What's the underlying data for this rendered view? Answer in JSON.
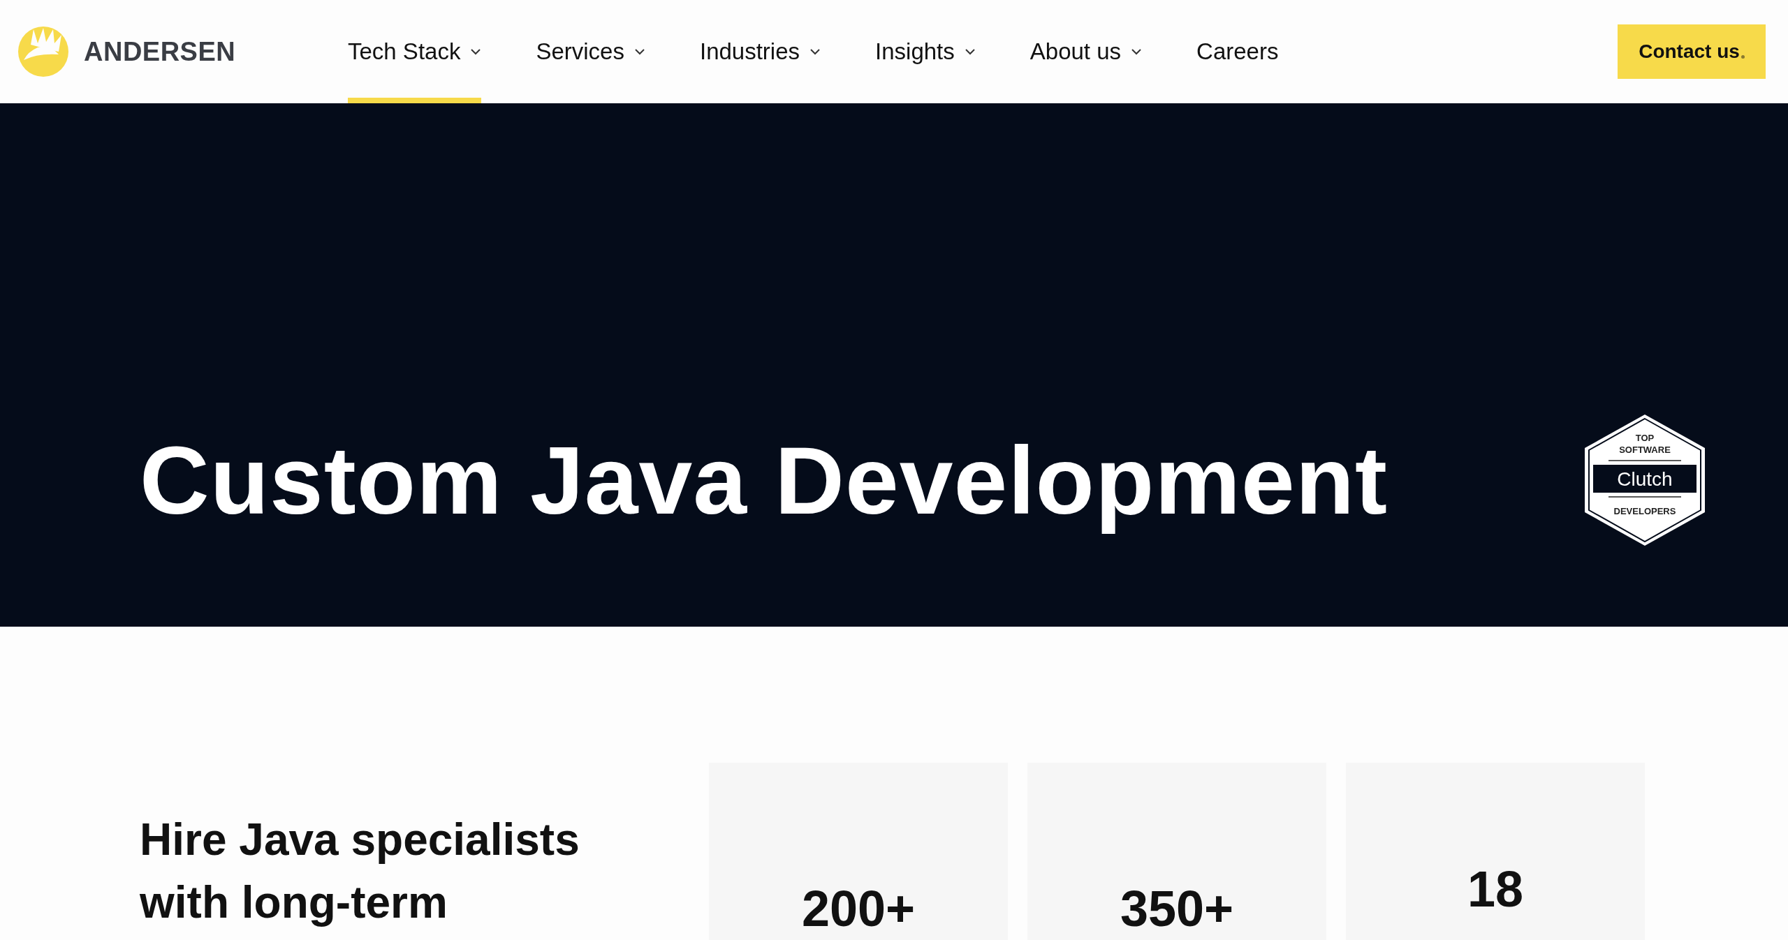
{
  "header": {
    "logo": "ANDERSEN",
    "nav": [
      {
        "label": "Tech Stack",
        "dropdown": true,
        "selected": true
      },
      {
        "label": "Services",
        "dropdown": true,
        "selected": false
      },
      {
        "label": "Industries",
        "dropdown": true,
        "selected": false
      },
      {
        "label": "Insights",
        "dropdown": true,
        "selected": false
      },
      {
        "label": "About us",
        "dropdown": true,
        "selected": false
      },
      {
        "label": "Careers",
        "dropdown": false,
        "selected": false
      }
    ],
    "contact_button": "Contact us"
  },
  "hero": {
    "title": "Custom Java Development",
    "badge": {
      "top": "TOP",
      "line2": "SOFTWARE",
      "brand": "Clutch",
      "bottom": "DEVELOPERS"
    }
  },
  "intro": {
    "heading": "Hire Java specialists with long-term",
    "stats": [
      {
        "value": "200+"
      },
      {
        "value": "350+"
      },
      {
        "value": "18"
      }
    ]
  }
}
